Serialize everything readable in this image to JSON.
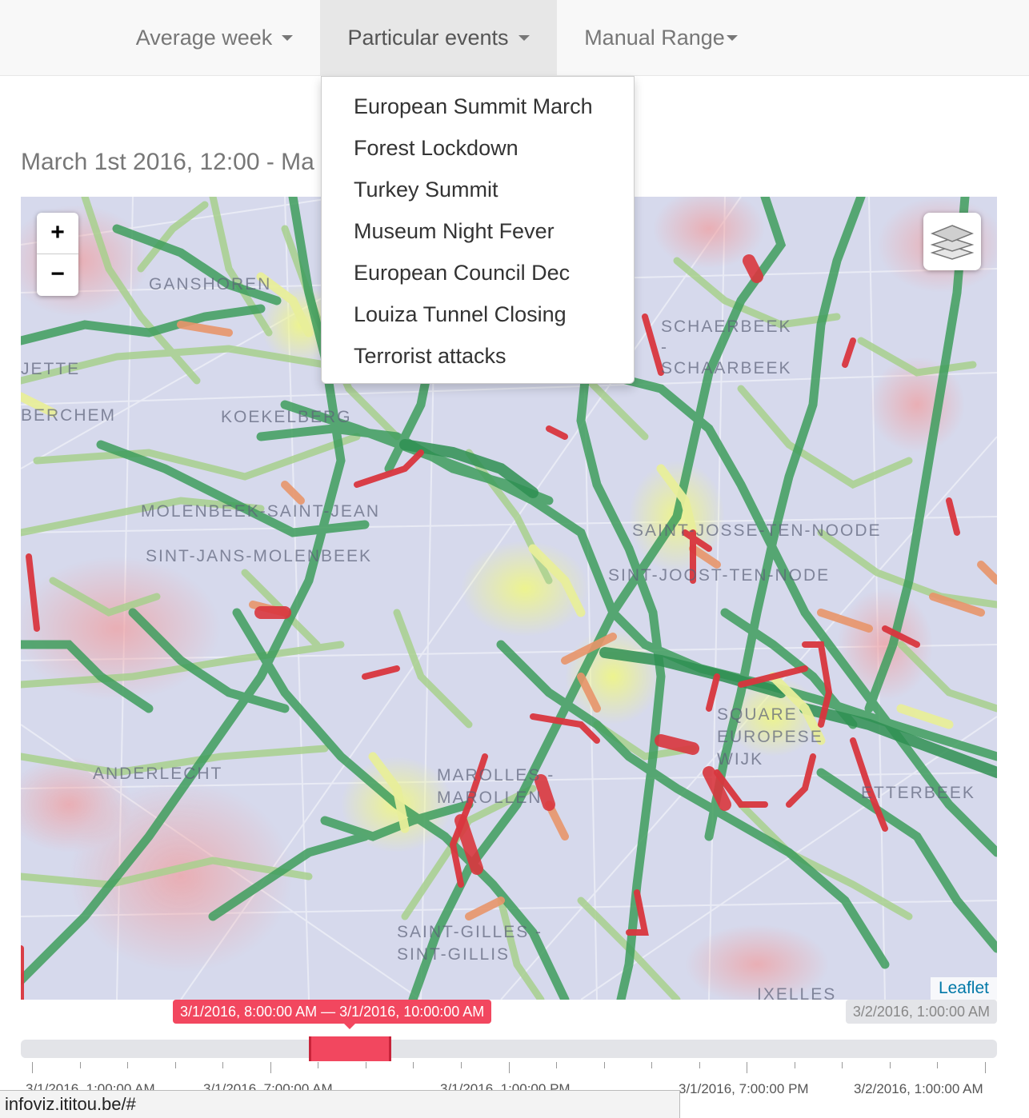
{
  "nav": {
    "items": [
      {
        "label": "Average week"
      },
      {
        "label": "Particular events"
      },
      {
        "label": "Manual Range"
      }
    ]
  },
  "dropdown": {
    "items": [
      "European Summit March",
      "Forest Lockdown",
      "Turkey Summit",
      "Museum Night Fever",
      "European Council Dec",
      "Louiza Tunnel Closing",
      "Terrorist attacks"
    ]
  },
  "range_title": "March 1st 2016, 12:00 - Ma",
  "map": {
    "zoom_in": "+",
    "zoom_out": "−",
    "attribution": "Leaflet",
    "districts": [
      "GANSHOREN",
      "JETTE",
      "KOEKELBERG",
      "BERCHEM",
      "MOLENBEEK-SAINT-JEAN",
      "SINT-JANS-MOLENBEEK",
      "SCHAERBEEK - SCHAARBEEK",
      "SAINT-JOSSE-TEN-NOODE",
      "SINT-JOOST-TEN-NODE",
      "SQUARE EUROPESE WIJK",
      "ETTERBEEK",
      "ANDERLECHT",
      "MAROLLES - MAROLLEN",
      "SAINT-GILLES - SINT-GILLIS",
      "IXELLES"
    ]
  },
  "slider": {
    "selection_label": "3/1/2016, 8:00:00 AM — 3/1/2016, 10:00:00 AM",
    "max_label": "3/2/2016, 1:00:00 AM",
    "axis_labels": [
      "3/1/2016, 1:00:00 AM",
      "3/1/2016, 7:00:00 AM",
      "3/1/2016, 1:00:00 PM",
      "3/1/2016, 7:00:00 PM",
      "3/2/2016, 1:00:00 AM"
    ]
  },
  "status_url": "infoviz.ititou.be/#",
  "colors": {
    "accent": "#f2475f",
    "road_green": "#3f9e5d",
    "road_light": "#a8d08d",
    "road_red": "#d9363e",
    "road_yellow": "#e8ee9a",
    "map_bg": "#d6d9ec"
  }
}
